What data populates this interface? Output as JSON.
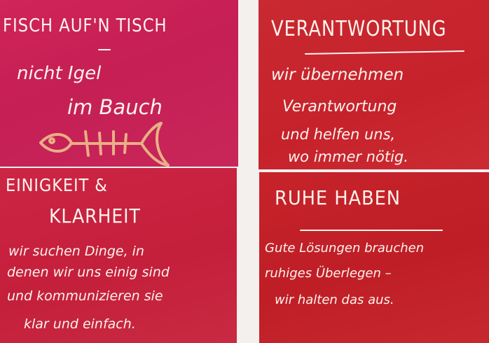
{
  "cards": [
    {
      "title": "FISCH AUF'N TISCH",
      "lines": [
        "nicht Igel",
        "im Bauch"
      ]
    },
    {
      "title": "VERANTWORTUNG",
      "lines": [
        "wir übernehmen",
        "Verantwortung",
        "und helfen uns,",
        "wo immer nötig."
      ]
    },
    {
      "title": [
        "EINIGKEIT &",
        "KLARHEIT"
      ],
      "lines": [
        "wir suchen Dinge, in",
        "denen wir uns einig sind",
        "und kommunizieren sie",
        "klar und einfach."
      ]
    },
    {
      "title": "RUHE HABEN",
      "lines": [
        "Gute Lösungen brauchen",
        "ruhiges Überlegen –",
        "wir halten das aus."
      ]
    }
  ],
  "colors": {
    "magenta_card": "#c8245a",
    "red_card": "#c6222c",
    "chalk": "#fbf3ec"
  },
  "icons": [
    "fish-skeleton-drawing"
  ]
}
